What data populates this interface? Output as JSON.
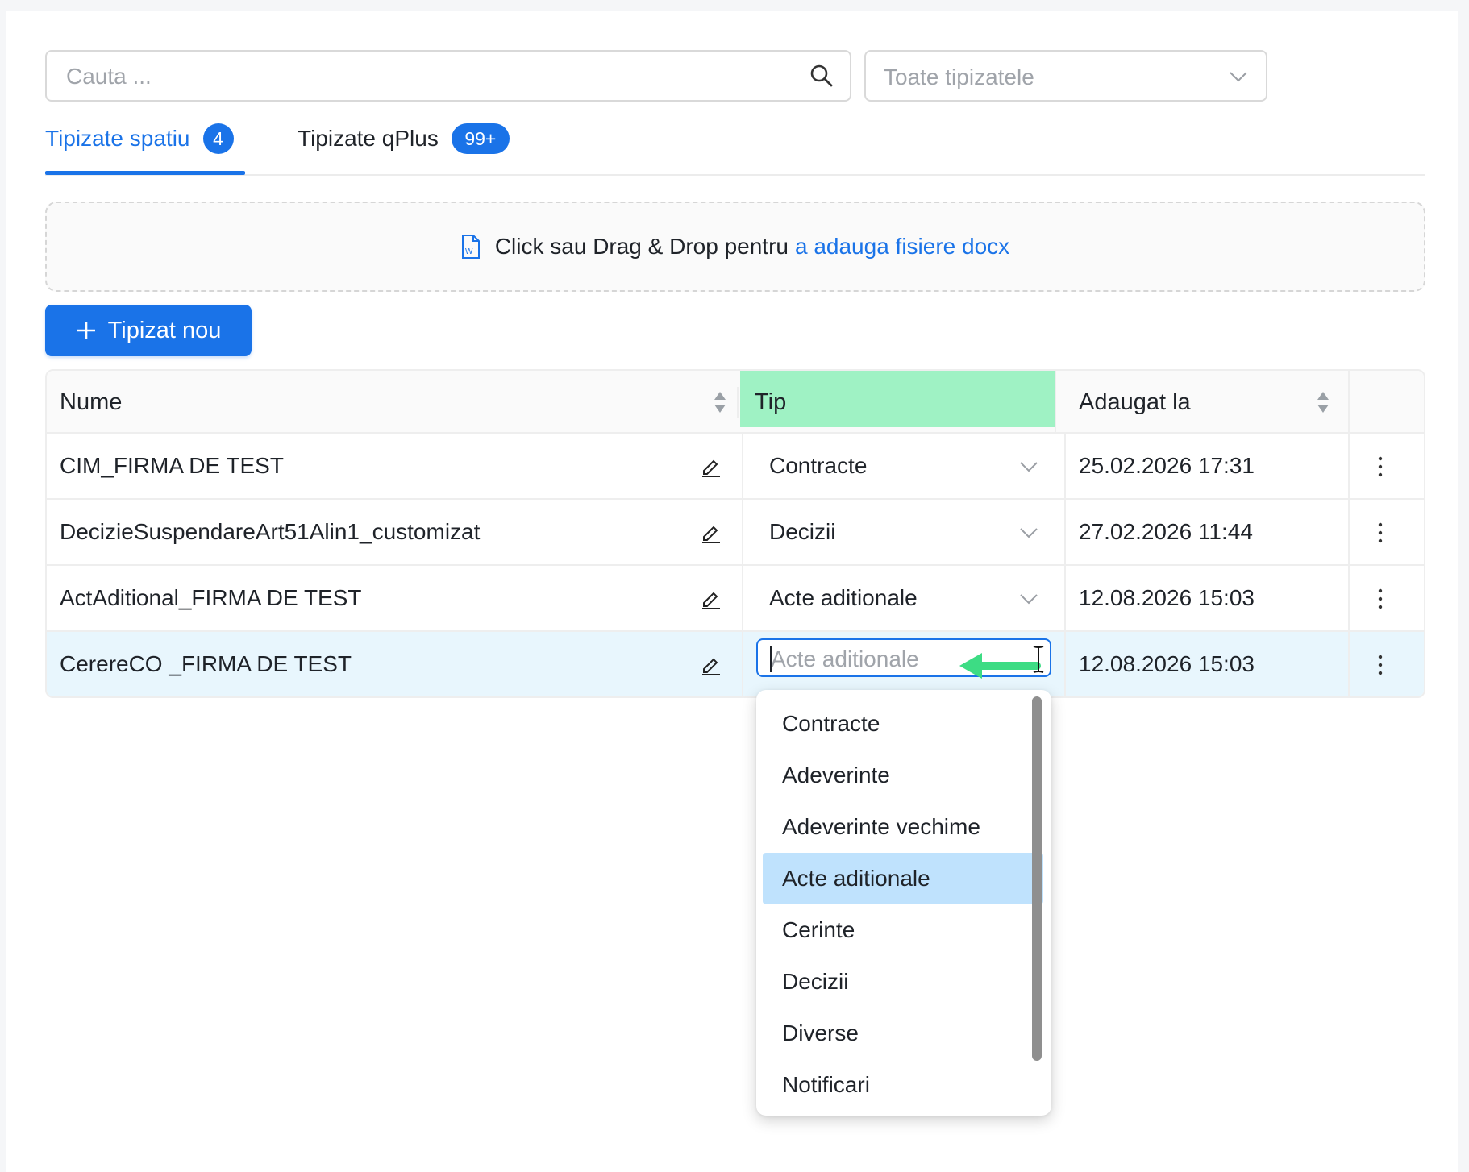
{
  "search": {
    "placeholder": "Cauta ..."
  },
  "type_filter": {
    "placeholder": "Toate tipizatele"
  },
  "tabs": [
    {
      "label": "Tipizate spatiu",
      "badge": "4",
      "active": true
    },
    {
      "label": "Tipizate qPlus",
      "badge": "99+",
      "active": false
    }
  ],
  "dropzone": {
    "text": "Click sau Drag & Drop pentru",
    "link": "a adauga fisiere docx"
  },
  "new_button": {
    "label": "Tipizat nou"
  },
  "table": {
    "headers": {
      "name": "Nume",
      "type": "Tip",
      "added": "Adaugat la"
    },
    "rows": [
      {
        "name": "CIM_FIRMA DE TEST",
        "type": "Contracte",
        "added": "25.02.2026 17:31"
      },
      {
        "name": "DecizieSuspendareArt51Alin1_customizat",
        "type": "Decizii",
        "added": "27.02.2026 11:44"
      },
      {
        "name": "ActAditional_FIRMA DE TEST",
        "type": "Acte aditionale",
        "added": "12.08.2026 15:03"
      },
      {
        "name": "CerereCO _FIRMA DE TEST",
        "type_placeholder": "Acte aditionale",
        "added": "12.08.2026 15:03"
      }
    ]
  },
  "dropdown": {
    "options": [
      "Contracte",
      "Adeverinte",
      "Adeverinte vechime",
      "Acte aditionale",
      "Cerinte",
      "Decizii",
      "Diverse",
      "Notificari"
    ],
    "selected": "Acte aditionale"
  },
  "colors": {
    "primary": "#1a73e8",
    "highlight_header": "#9ff2c4",
    "selected_row": "#e8f6fd",
    "selected_option": "#bfe2fd",
    "annotation_arrow": "#3ddc84"
  }
}
